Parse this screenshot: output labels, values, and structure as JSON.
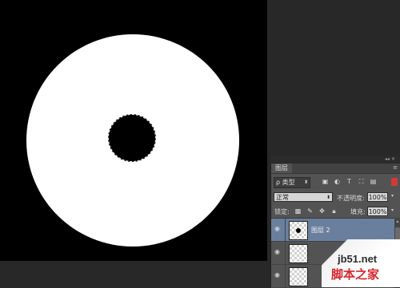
{
  "canvas": {
    "background_color": "#000000",
    "shape_color": "#ffffff"
  },
  "layers_panel": {
    "tab_title": "图层",
    "filter": {
      "kind_label": "类型",
      "icons": [
        "image-filter-icon",
        "adjustment-filter-icon",
        "type-filter-icon",
        "shape-filter-icon",
        "smart-object-filter-icon"
      ]
    },
    "blend_mode": "正常",
    "opacity_label": "不透明度:",
    "opacity_value": "100%",
    "lock_label": "锁定:",
    "lock_icons": [
      "lock-transparency-icon",
      "lock-image-icon",
      "lock-position-icon",
      "lock-all-icon"
    ],
    "fill_label": "填充:",
    "fill_value": "100%",
    "layers": [
      {
        "name": "图层 2",
        "selected": true,
        "visible": true
      },
      {
        "name": "",
        "selected": false,
        "visible": true
      },
      {
        "name": "",
        "selected": false,
        "visible": true
      }
    ],
    "selection_color": "#6a7f9e"
  },
  "watermark": {
    "line1": "jb51.net",
    "line2": "脚本之家"
  }
}
